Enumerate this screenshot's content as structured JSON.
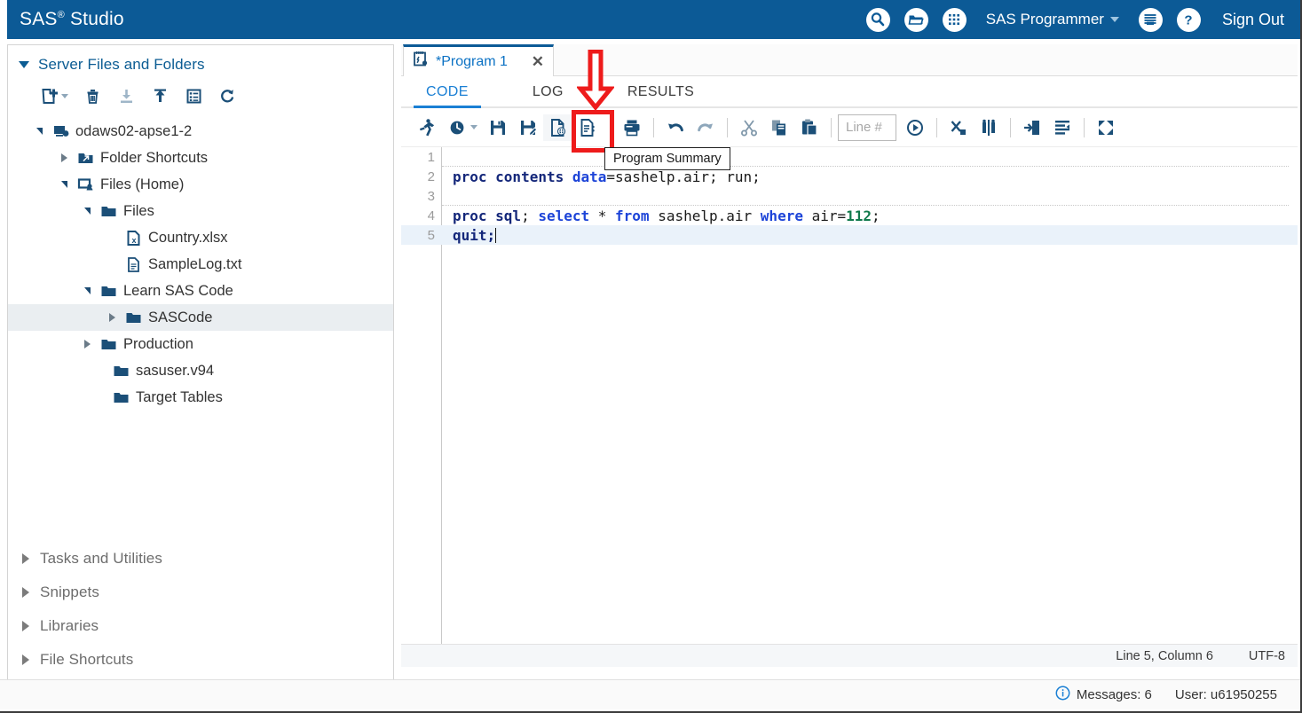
{
  "header": {
    "title_main": "SAS",
    "title_sup": "®",
    "title_rest": " Studio",
    "icons": [
      "search-icon",
      "open-folder-icon",
      "grid-apps-icon",
      "options-lines-icon",
      "help-question-icon"
    ],
    "user_menu": "SAS Programmer",
    "sign_out": "Sign Out",
    "bg_color": "#0c5a96"
  },
  "sidebar": {
    "section_title": "Server Files and Folders",
    "toolbar": [
      {
        "name": "new-file-button",
        "label": "New"
      },
      {
        "name": "delete-button",
        "label": "Delete"
      },
      {
        "name": "download-button",
        "label": "Download"
      },
      {
        "name": "upload-button",
        "label": "Upload"
      },
      {
        "name": "properties-button",
        "label": "Properties"
      },
      {
        "name": "refresh-button",
        "label": "Refresh"
      }
    ],
    "tree": [
      {
        "label": "odaws02-apse1-2",
        "icon": "server-icon",
        "indent": 0,
        "state": "expanded"
      },
      {
        "label": "Folder Shortcuts",
        "icon": "shortcut-folder-icon",
        "indent": 1,
        "state": "collapsed"
      },
      {
        "label": "Files (Home)",
        "icon": "home-files-icon",
        "indent": 1,
        "state": "expanded"
      },
      {
        "label": "Files",
        "icon": "folder-icon",
        "indent": 2,
        "state": "expanded"
      },
      {
        "label": "Country.xlsx",
        "icon": "excel-file-icon",
        "indent": 3,
        "state": "leaf"
      },
      {
        "label": "SampleLog.txt",
        "icon": "text-file-icon",
        "indent": 3,
        "state": "leaf"
      },
      {
        "label": "Learn SAS Code",
        "icon": "folder-icon",
        "indent": 2,
        "state": "expanded"
      },
      {
        "label": "SASCode",
        "icon": "folder-icon",
        "indent": 3,
        "state": "collapsed",
        "selected": true
      },
      {
        "label": "Production",
        "icon": "folder-icon",
        "indent": 2,
        "state": "collapsed"
      },
      {
        "label": "sasuser.v94",
        "icon": "folder-icon",
        "indent": 2,
        "state": "leaf"
      },
      {
        "label": "Target Tables",
        "icon": "folder-icon",
        "indent": 2,
        "state": "leaf"
      }
    ],
    "collapsed_sections": [
      "Tasks and Utilities",
      "Snippets",
      "Libraries",
      "File Shortcuts"
    ]
  },
  "editor": {
    "tab_label": "*Program 1",
    "tab_close": "✕",
    "subtabs": [
      {
        "label": "CODE",
        "active": true
      },
      {
        "label": "LOG",
        "active": false
      },
      {
        "label": "RESULTS",
        "active": false
      }
    ],
    "toolbar": [
      {
        "name": "run-button",
        "label": "Run"
      },
      {
        "name": "history-button",
        "label": "History"
      },
      {
        "name": "save-button",
        "label": "Save"
      },
      {
        "name": "save-as-button",
        "label": "Save As"
      },
      {
        "name": "program-summary-button",
        "label": "Program Summary",
        "highlighted": true
      },
      {
        "name": "code-properties-button",
        "label": "Properties"
      },
      {
        "name": "print-button",
        "label": "Print"
      },
      {
        "name": "undo-button",
        "label": "Undo"
      },
      {
        "name": "redo-button",
        "label": "Redo"
      },
      {
        "name": "cut-button",
        "label": "Cut"
      },
      {
        "name": "copy-button",
        "label": "Copy"
      },
      {
        "name": "paste-button",
        "label": "Paste"
      },
      {
        "name": "goto-line-button",
        "label": "Go to line"
      },
      {
        "name": "clear-all-button",
        "label": "Clear all"
      },
      {
        "name": "compare-button",
        "label": "Compare"
      },
      {
        "name": "indent-button",
        "label": "Indent"
      },
      {
        "name": "format-button",
        "label": "Format code"
      },
      {
        "name": "maximize-button",
        "label": "Maximize view"
      }
    ],
    "line_number_placeholder": "Line #",
    "line_number_value": "",
    "tooltip": "Program Summary",
    "code_lines": [
      {
        "n": "1",
        "text": "",
        "sep_after": true
      },
      {
        "n": "2",
        "text": "proc contents data=sashelp.air; run;"
      },
      {
        "n": "3",
        "text": "",
        "sep_after": true
      },
      {
        "n": "4",
        "text": "proc sql; select * from sashelp.air where air=112;"
      },
      {
        "n": "5",
        "text": "quit;",
        "current": true
      }
    ],
    "status": {
      "position": "Line 5, Column 6",
      "encoding": "UTF-8"
    }
  },
  "app_status": {
    "messages": "Messages: 6",
    "user": "User: u61950255",
    "info_icon": "info-icon"
  },
  "colors": {
    "brand_blue": "#0c5a96",
    "link_blue": "#0b5c93",
    "accent_blue": "#1a7fd4",
    "annotation_red": "#ee1b1b",
    "selected_row": "#eaeef1",
    "current_line": "#eaf2fa"
  }
}
